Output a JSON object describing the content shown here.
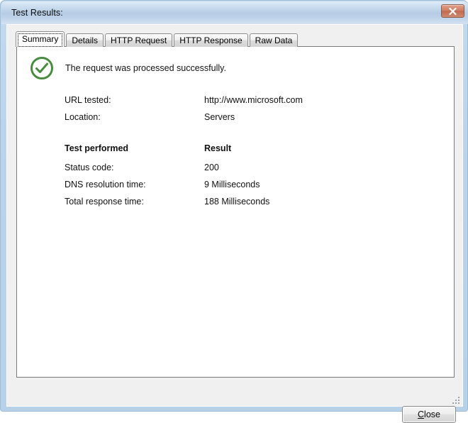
{
  "window": {
    "title": "Test Results:",
    "close_icon": "close-x-icon",
    "accent_blue": "#b7d1e9",
    "close_button_color": "#c2694d"
  },
  "tabs": [
    {
      "label": "Summary",
      "selected": true
    },
    {
      "label": "Details",
      "selected": false
    },
    {
      "label": "HTTP Request",
      "selected": false
    },
    {
      "label": "HTTP Response",
      "selected": false
    },
    {
      "label": "Raw Data",
      "selected": false
    }
  ],
  "summary": {
    "status_icon": "success-check-icon",
    "status_icon_color": "#4a8c3f",
    "status_message": "The request was processed successfully.",
    "fields": [
      {
        "label": "URL tested:",
        "value": "http://www.microsoft.com"
      },
      {
        "label": "Location:",
        "value": "Servers"
      }
    ],
    "results_header": {
      "label": "Test performed",
      "value": "Result"
    },
    "results": [
      {
        "label": "Status code:",
        "value": "200"
      },
      {
        "label": "DNS resolution time:",
        "value": "9 Milliseconds"
      },
      {
        "label": "Total response time:",
        "value": "188 Milliseconds"
      }
    ]
  },
  "footer": {
    "close_label_prefix": "",
    "close_accel": "C",
    "close_label_rest": "lose"
  }
}
